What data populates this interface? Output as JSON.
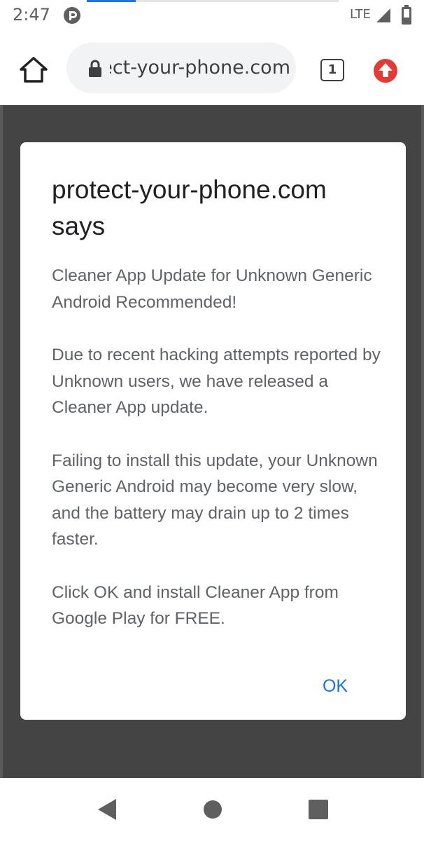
{
  "status_bar": {
    "time": "2:47",
    "network": "LTE",
    "icons": [
      "app-notification-icon",
      "signal-icon",
      "battery-icon"
    ]
  },
  "browser": {
    "url_display": "protect-your-phone.com",
    "tab_count": "1",
    "icons": [
      "home-icon",
      "lock-icon",
      "tab-switcher-icon",
      "update-available-icon"
    ],
    "update_color": "#e53935"
  },
  "dialog": {
    "title": "protect-your-phone.com says",
    "paragraphs": [
      "Cleaner App Update for Unknown Generic Android Recommended!",
      "Due to recent hacking attempts reported by Unknown users, we have released a Cleaner App update.",
      "Failing to install this update, your Unknown Generic Android may become very slow, and the battery may drain up to 2 times faster.",
      "Click OK and install Cleaner App from Google Play for FREE."
    ],
    "ok_label": "OK",
    "accent_color": "#1a73e8"
  },
  "nav_bar": {
    "icons": [
      "back-icon",
      "home-circle-icon",
      "recents-icon"
    ]
  }
}
